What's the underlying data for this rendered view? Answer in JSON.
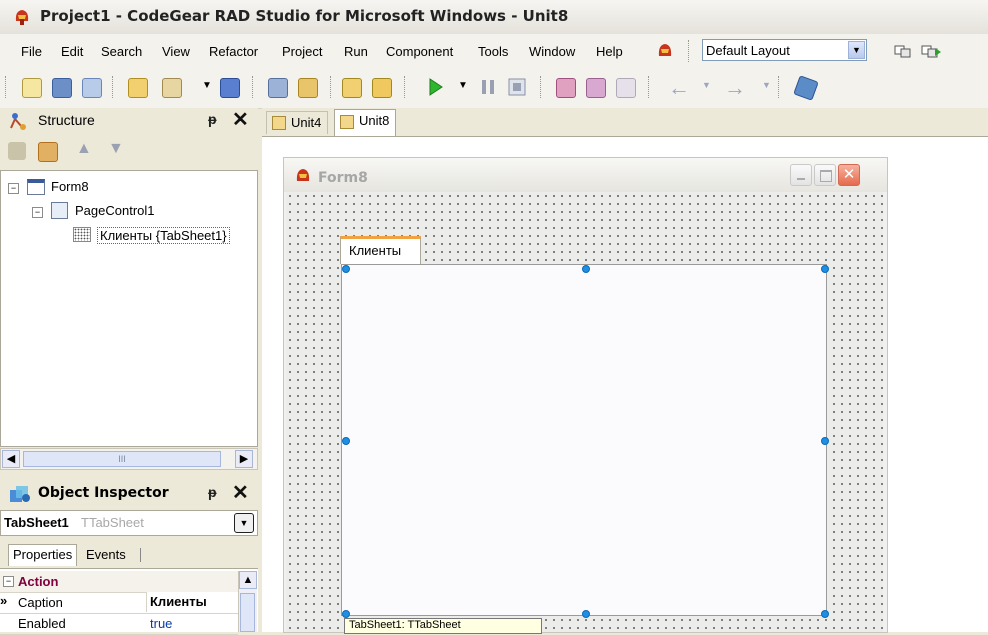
{
  "window": {
    "title": "Project1 - CodeGear RAD Studio for Microsoft Windows - Unit8"
  },
  "menu": [
    "File",
    "Edit",
    "Search",
    "View",
    "Refactor",
    "Project",
    "Run",
    "Component",
    "Tools",
    "Window",
    "Help"
  ],
  "layout_select": {
    "value": "Default Layout"
  },
  "structure": {
    "title": "Structure",
    "tree": [
      "Form8",
      "PageControl1",
      "Клиенты {TabSheet1}"
    ],
    "scroll_grip": "III"
  },
  "object_inspector": {
    "title": "Object Inspector",
    "selected_object": "TabSheet1",
    "selected_type": "TTabSheet",
    "tabs": [
      "Properties",
      "Events"
    ],
    "category": "Action",
    "props": [
      {
        "name": "Caption",
        "value": "Клиенты"
      },
      {
        "name": "Enabled",
        "value": "true"
      }
    ]
  },
  "editor_tabs": [
    "Unit4",
    "Unit8"
  ],
  "form": {
    "title": "Form8",
    "page_tab": "Клиенты",
    "hint": "TabSheet1: TTabSheet"
  }
}
